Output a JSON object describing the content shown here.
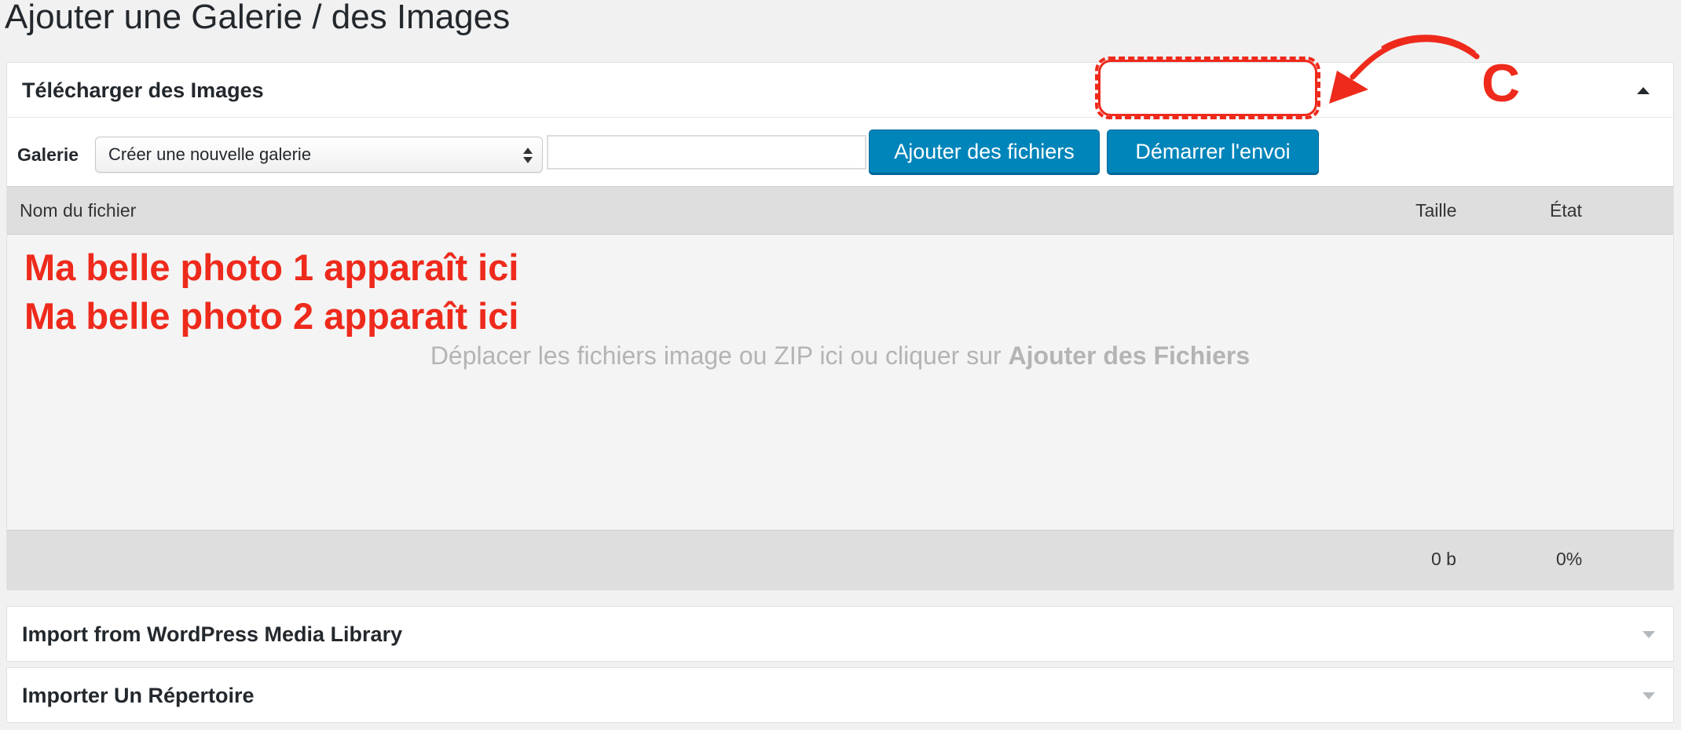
{
  "page": {
    "title": "Ajouter une Galerie / des Images"
  },
  "upload_panel": {
    "title": "Télécharger des Images",
    "gallery_label": "Galerie",
    "gallery_select_value": "Créer une nouvelle galerie",
    "gallery_name_value": "",
    "add_files_button": "Ajouter des fichiers",
    "start_upload_button": "Démarrer l'envoi",
    "columns": {
      "name": "Nom du fichier",
      "size": "Taille",
      "state": "État"
    },
    "notes": [
      "Ma belle photo 1 apparaît ici",
      "Ma belle photo 2 apparaît ici"
    ],
    "drop_hint_text": "Déplacer les fichiers image ou ZIP ici ou cliquer sur ",
    "drop_hint_bold": "Ajouter des Fichiers",
    "total_size": "0 b",
    "total_percent": "0%"
  },
  "annotation": {
    "letter": "C",
    "color": "#ee2a1c"
  },
  "import_wp_panel": {
    "title": "Import from WordPress Media Library"
  },
  "import_dir_panel": {
    "title": "Importer Un Répertoire"
  },
  "colors": {
    "primary_button": "#0085ba",
    "background": "#f1f1f1",
    "header_bar": "#dedede"
  },
  "icons": {
    "collapse": "triangle-up-icon",
    "expand": "triangle-down-icon",
    "select": "select-arrows-icon"
  }
}
